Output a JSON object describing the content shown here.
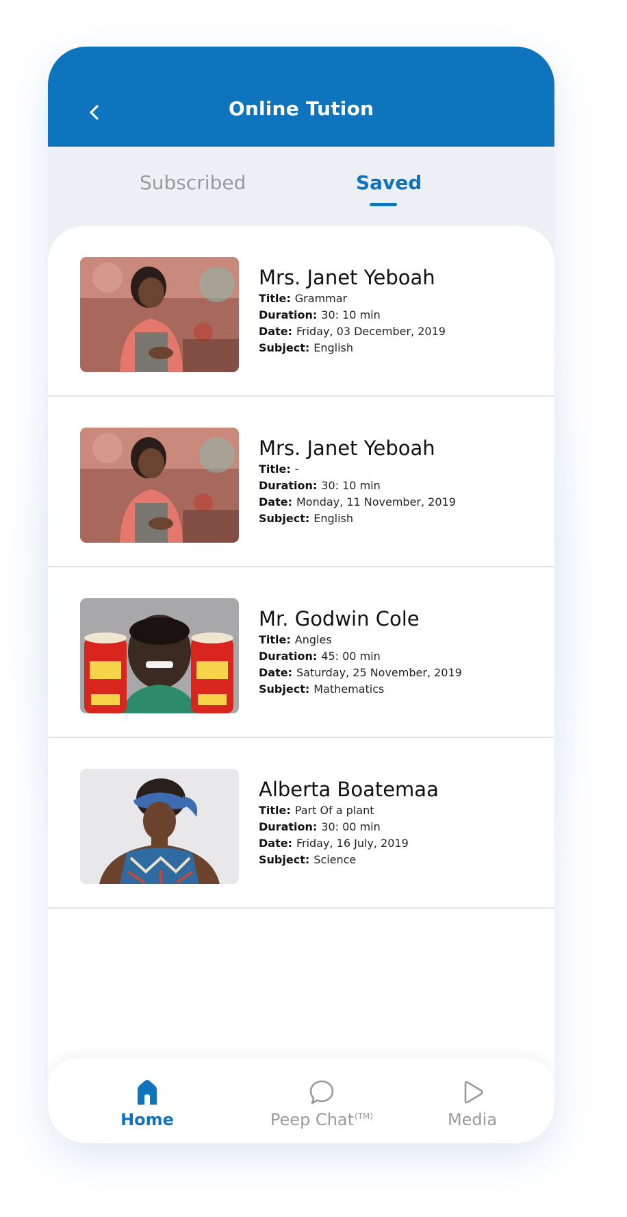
{
  "header": {
    "title": "Online Tution",
    "background_color": "#0e74bd",
    "back_icon": "chevron-left-icon"
  },
  "tabs": [
    {
      "label": "Subscribed",
      "active": false
    },
    {
      "label": "Saved",
      "active": true
    }
  ],
  "tutors": [
    {
      "name": "Mrs. Janet Yeboah",
      "title_label": "Title:",
      "title": "Grammar",
      "duration_label": "Duration:",
      "duration": "30: 10 min",
      "date_label": "Date:",
      "date": "Friday, 03 December, 2019",
      "subject_label": "Subject:",
      "subject": "English"
    },
    {
      "name": "Mrs. Janet Yeboah",
      "title_label": "Title:",
      "title": "-",
      "duration_label": "Duration:",
      "duration": "30: 10 min",
      "date_label": "Date:",
      "date": "Monday, 11 November, 2019",
      "subject_label": "Subject:",
      "subject": "English"
    },
    {
      "name": "Mr. Godwin Cole",
      "title_label": "Title:",
      "title": "Angles",
      "duration_label": "Duration:",
      "duration": "45: 00 min",
      "date_label": "Date:",
      "date": "Saturday, 25 November, 2019",
      "subject_label": "Subject:",
      "subject": "Mathematics"
    },
    {
      "name": "Alberta Boatemaa",
      "title_label": "Title:",
      "title": "Part Of a plant",
      "duration_label": "Duration:",
      "duration": "30: 00 min",
      "date_label": "Date:",
      "date": "Friday, 16 July, 2019",
      "subject_label": "Subject:",
      "subject": "Science"
    }
  ],
  "bottom_nav": {
    "home": {
      "label": "Home",
      "icon": "home-icon",
      "active": true
    },
    "chat": {
      "label": "Peep Chat",
      "suffix": "(TM)",
      "icon": "chat-bubble-icon",
      "active": false
    },
    "media": {
      "label": "Media",
      "icon": "play-icon",
      "active": false
    }
  },
  "colors": {
    "accent": "#0e74bd",
    "inactive_text": "#9a9a9a",
    "tab_background": "#edf1f5"
  }
}
